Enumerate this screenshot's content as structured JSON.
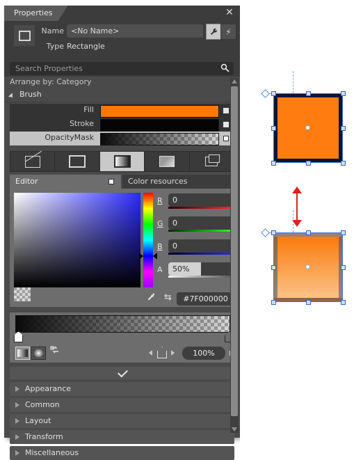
{
  "panel": {
    "tab_label": "Properties",
    "close_icon": "✕",
    "identity": {
      "shape_icon": "rectangle-icon",
      "name_label": "Name",
      "name_value": "<No Name>",
      "type_label": "Type",
      "type_value": "Rectangle",
      "wrench_icon": "🔧",
      "flash_icon": "⚡"
    },
    "search": {
      "placeholder": "Search Properties",
      "icon": "search-icon"
    },
    "arrange_label": "Arrange by: Category",
    "brush": {
      "group_label": "Brush",
      "rows": [
        {
          "label": "Fill",
          "color": "#FF7800",
          "kind": "solid"
        },
        {
          "label": "Stroke",
          "color": "#050505",
          "kind": "solid"
        },
        {
          "label": "OpacityMask",
          "color": "#000000",
          "kind": "gradient-checker"
        }
      ],
      "types": [
        {
          "name": "no-brush",
          "selected": false
        },
        {
          "name": "solid-color-brush",
          "selected": false
        },
        {
          "name": "gradient-brush",
          "selected": true
        },
        {
          "name": "image-brush",
          "selected": false
        },
        {
          "name": "drawing-brush",
          "selected": false
        }
      ]
    },
    "editor_tabs": {
      "editor_label": "Editor",
      "color_resources_label": "Color resources"
    },
    "color": {
      "channels": [
        {
          "label": "R",
          "value": "0"
        },
        {
          "label": "G",
          "value": "0"
        },
        {
          "label": "B",
          "value": "0"
        }
      ],
      "alpha_label": "A",
      "alpha_value": "50%",
      "alpha_percent": 50,
      "hex": "#7F000000",
      "eyedropper_icon": "⚲",
      "swap_icon": "⇆"
    },
    "gradient": {
      "linear_icon": "linear-gradient-icon",
      "radial_icon": "radial-gradient-icon",
      "reverse_icon": "⇄",
      "stop_position": "100%",
      "stops": [
        {
          "name": "gradient-stop-start",
          "selected": true
        },
        {
          "name": "gradient-stop-end",
          "selected": false
        }
      ]
    },
    "categories": [
      {
        "label": "Appearance"
      },
      {
        "label": "Common"
      },
      {
        "label": "Layout"
      },
      {
        "label": "Transform"
      },
      {
        "label": "Miscellaneous"
      }
    ]
  },
  "canvas": {
    "shapes": [
      {
        "name": "rectangle-solid",
        "fill": "#FF7D10",
        "stroke": "#0C1430"
      },
      {
        "name": "rectangle-masked",
        "fill": "#F97B0C",
        "stroke": "#3C5078"
      }
    ],
    "annotation_arrow": "double-arrow-vertical"
  }
}
